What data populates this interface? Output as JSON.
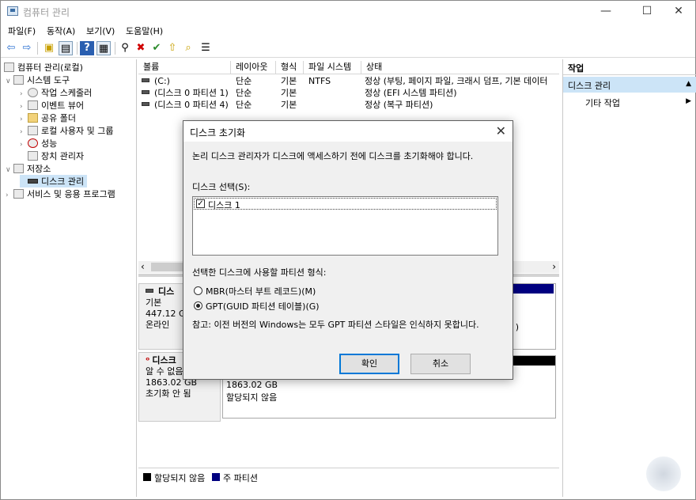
{
  "window": {
    "title": "컴퓨터 관리",
    "min": "—",
    "max": "☐",
    "close": "✕"
  },
  "menu": [
    "파일(F)",
    "동작(A)",
    "보기(V)",
    "도움말(H)"
  ],
  "toolbar": {
    "back": "⇦",
    "forward": "⇨",
    "up": "▣",
    "show": "▤",
    "help": "?",
    "props": "▦",
    "connect": "⚲",
    "delete": "✖",
    "check": "✔",
    "upload": "⇧",
    "search": "⌕",
    "list": "☰"
  },
  "tree": [
    {
      "label": "컴퓨터 관리(로컬)",
      "exp": "",
      "indent": 0
    },
    {
      "label": "시스템 도구",
      "exp": "∨",
      "indent": 1
    },
    {
      "label": "작업 스케줄러",
      "exp": "›",
      "indent": 2
    },
    {
      "label": "이벤트 뷰어",
      "exp": "›",
      "indent": 2
    },
    {
      "label": "공유 폴더",
      "exp": "›",
      "indent": 2
    },
    {
      "label": "로컬 사용자 및 그룹",
      "exp": "›",
      "indent": 2
    },
    {
      "label": "성능",
      "exp": "›",
      "indent": 2
    },
    {
      "label": "장치 관리자",
      "exp": "",
      "indent": 2
    },
    {
      "label": "저장소",
      "exp": "∨",
      "indent": 1
    },
    {
      "label": "디스크 관리",
      "exp": "",
      "indent": 2
    },
    {
      "label": "서비스 및 응용 프로그램",
      "exp": "›",
      "indent": 1
    }
  ],
  "columns": [
    "볼륨",
    "레이아웃",
    "형식",
    "파일 시스템",
    "상태"
  ],
  "volumes": [
    {
      "vol": "(C:)",
      "layout": "단순",
      "type": "기본",
      "fs": "NTFS",
      "status": "정상 (부팅, 페이지 파일, 크래시 덤프, 기본 데이터"
    },
    {
      "vol": "(디스크 0 파티션 1)",
      "layout": "단순",
      "type": "기본",
      "fs": "",
      "status": "정상 (EFI 시스템 파티션)"
    },
    {
      "vol": "(디스크 0 파티션 4)",
      "layout": "단순",
      "type": "기본",
      "fs": "",
      "status": "정상 (복구 파티션)"
    }
  ],
  "scroll": {
    "left": "‹",
    "right": "›"
  },
  "disk0": {
    "name": "디스",
    "type": "기본",
    "size": "447.12 GB",
    "state": "온라인",
    "frag": ")"
  },
  "disk1": {
    "name": "디스크",
    "type": "알 수 없음",
    "size": "1863.02 GB",
    "state": "초기화 안 됨",
    "part_size": "1863.02 GB",
    "part_state": "할당되지 않음"
  },
  "legend": {
    "unallocated": "할당되지 않음",
    "primary": "주 파티션"
  },
  "legend_colors": {
    "unallocated": "#000000",
    "primary": "#000080"
  },
  "actions": {
    "header": "작업",
    "section": "디스크 관리",
    "collapse": "▲",
    "more": "기타 작업",
    "more_arrow": "▶"
  },
  "dialog": {
    "title": "디스크 초기화",
    "close": "✕",
    "intro": "논리 디스크 관리자가 디스크에 액세스하기 전에 디스크를 초기화해야 합니다.",
    "select_label": "디스크 선택(S):",
    "disk_item": "디스크 1",
    "disk_checked": "✓",
    "partition_label": "선택한 디스크에 사용할 파티션 형식:",
    "mbr": "MBR(마스터 부트 레코드)(M)",
    "gpt": "GPT(GUID 파티션 테이블)(G)",
    "selected": "gpt",
    "note": "참고: 이전 버전의 Windows는 모두 GPT 파티션 스타일은 인식하지 못합니다.",
    "ok": "확인",
    "cancel": "취소"
  }
}
